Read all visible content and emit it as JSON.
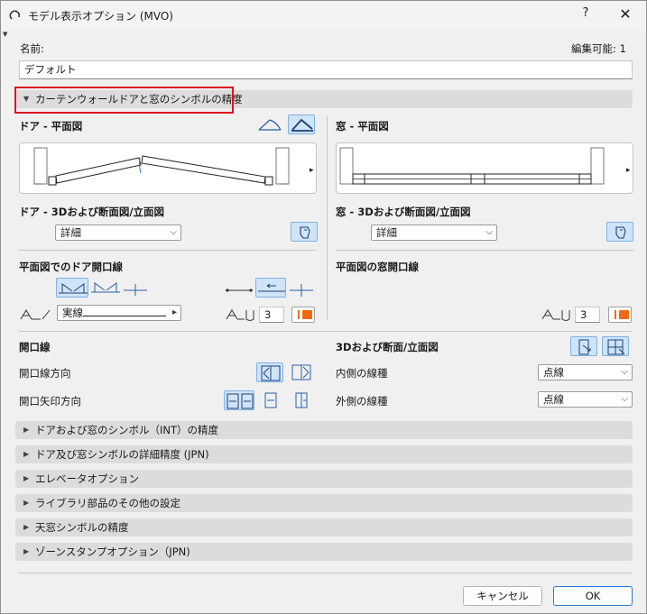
{
  "window": {
    "title": "モデル表示オプション (MVO)",
    "help": "?",
    "close": "✕"
  },
  "name_label": "名前:",
  "editable_label": "編集可能: 1",
  "name_value": "デフォルト",
  "section_main": {
    "title": "カーテンウォールドアと窓のシンボルの精度",
    "expanded": true
  },
  "door_plan": {
    "heading": "ドア - 平面図"
  },
  "window_plan": {
    "heading": "窓 - 平面図"
  },
  "door_3d": {
    "heading": "ドア - 3Dおよび断面図/立面図",
    "select_value": "詳細"
  },
  "window_3d": {
    "heading": "窓 - 3Dおよび断面図/立面図",
    "select_value": "詳細"
  },
  "door_opening_plan": {
    "heading": "平面図でのドア開口線",
    "linetype_value": "実線",
    "pen_value": "3"
  },
  "window_opening_plan": {
    "heading": "平面図の窓開口線",
    "pen_value": "3"
  },
  "opening_lines": {
    "heading": "開口線",
    "direction_label": "開口線方向",
    "arrow_label": "開口矢印方向"
  },
  "section_3d": {
    "heading": "3Dおよび断面/立面図",
    "inner_label": "内側の線種",
    "inner_value": "点線",
    "outer_label": "外側の線種",
    "outer_value": "点線"
  },
  "collapsed_sections": [
    "ドアおよび窓のシンボル（INT）の精度",
    "ドア及び窓シンボルの詳細精度 (JPN)",
    "エレベータオプション",
    "ライブラリ部品のその他の設定",
    "天窓シンボルの精度",
    "ゾーンスタンプオプション（JPN)"
  ],
  "buttons": {
    "cancel": "キャンセル",
    "ok": "OK"
  },
  "colors": {
    "accent": "#cfe4f8",
    "highlight_border": "#e0141e",
    "pen_color": "#f06a12"
  }
}
